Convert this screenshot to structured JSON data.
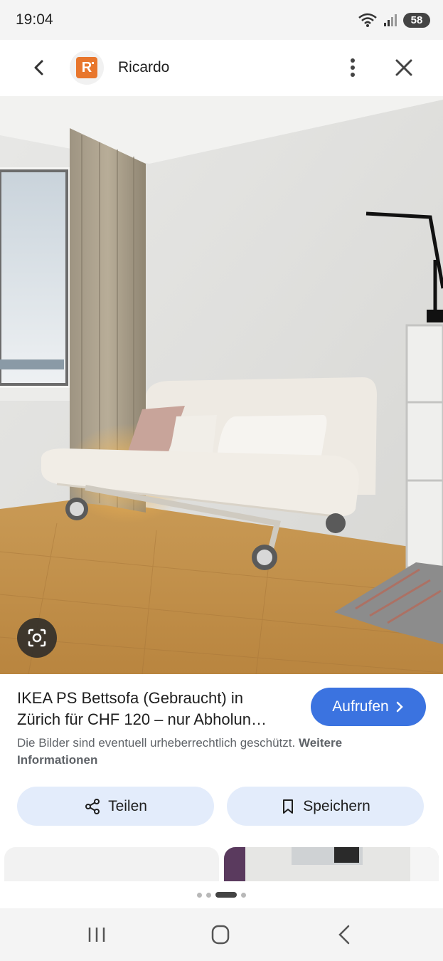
{
  "status_bar": {
    "time": "19:04",
    "battery": "58"
  },
  "header": {
    "site_name": "Ricardo",
    "logo_letter": "R"
  },
  "result": {
    "title_line1": "IKEA PS Bettsofa (Gebraucht) in",
    "title_line2": "Zürich für CHF 120 – nur Abholun…",
    "visit_label": "Aufrufen",
    "copyright_text": "Die Bilder sind eventuell urheberrechtlich geschützt.",
    "copyright_link": "Weitere Informationen"
  },
  "actions": {
    "share_label": "Teilen",
    "save_label": "Speichern"
  },
  "colors": {
    "accent": "#3b73e0",
    "action_bg": "#e3ecfb",
    "logo": "#e8762c"
  },
  "icons": [
    "back-icon",
    "more-vert-icon",
    "close-icon",
    "lens-icon",
    "chevron-right-icon",
    "share-icon",
    "bookmark-icon",
    "recent-apps-icon",
    "home-icon",
    "nav-back-icon"
  ]
}
